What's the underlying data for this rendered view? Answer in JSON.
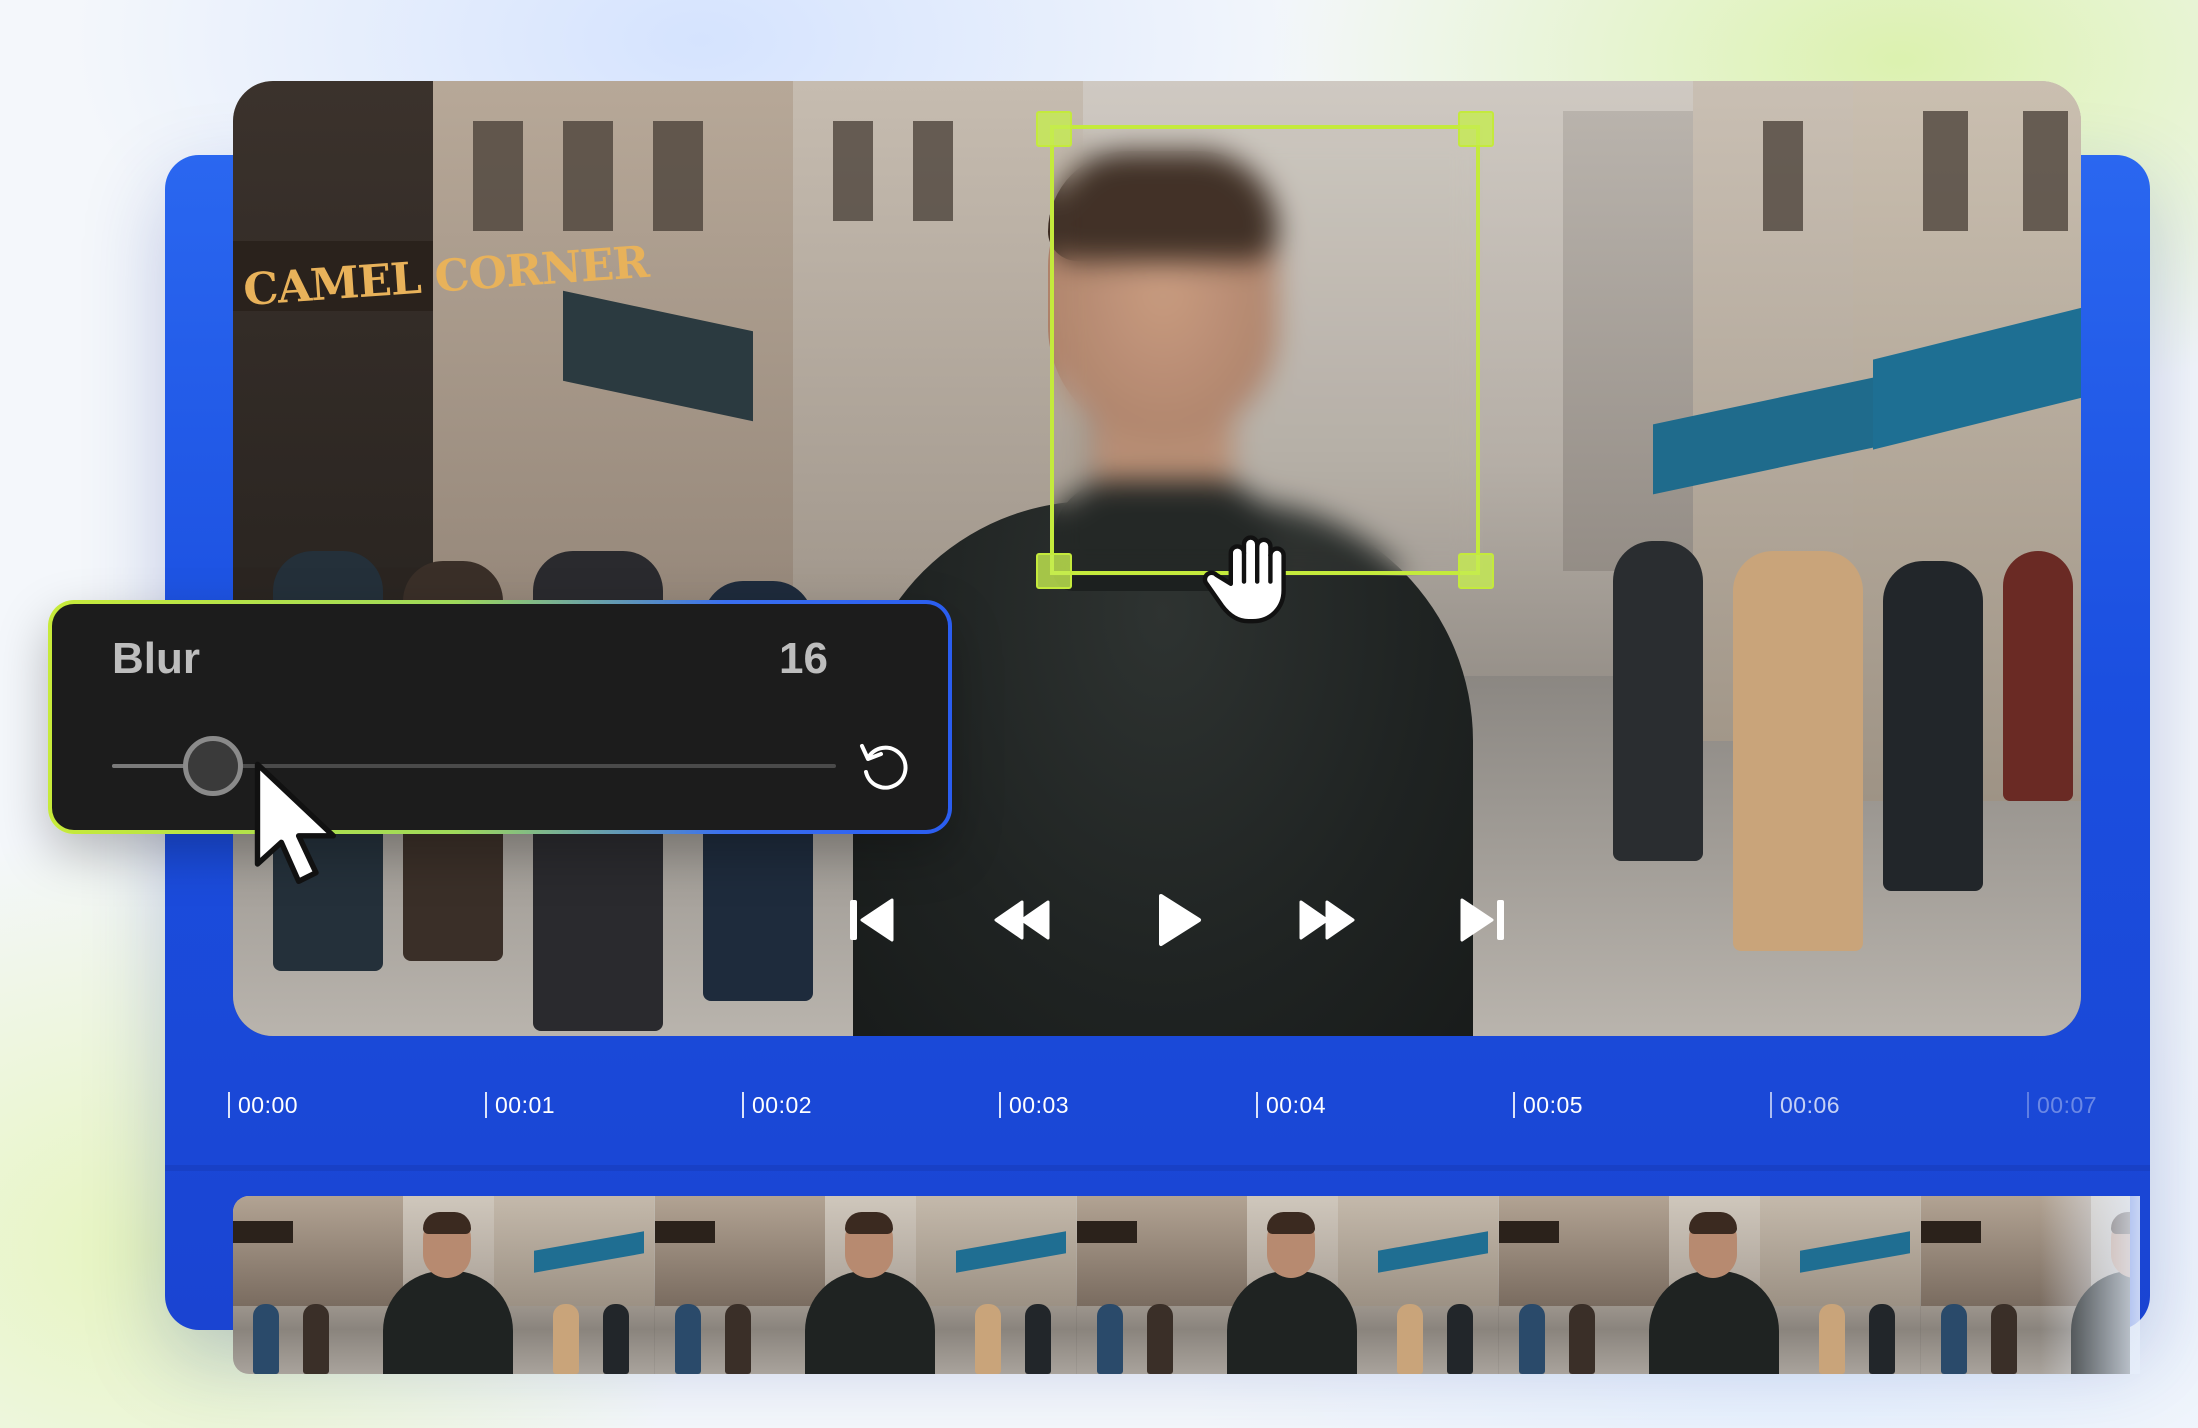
{
  "blur_panel": {
    "label": "Blur",
    "value": "16",
    "slider_fraction": 0.14
  },
  "timeline": {
    "timestamps": [
      "00:00",
      "00:01",
      "00:02",
      "00:03",
      "00:04",
      "00:05",
      "00:06",
      "00:07"
    ]
  },
  "playback": {
    "buttons": [
      "skip-back-icon",
      "rewind-icon",
      "play-icon",
      "fast-forward-icon",
      "skip-forward-icon"
    ]
  },
  "video_overlay": {
    "sign_text": "CAMEL CORNER"
  },
  "colors": {
    "accent_lime": "#c4ea3c",
    "panel_blue": "#2a67f0",
    "panel_dark": "#1c1c1c"
  }
}
